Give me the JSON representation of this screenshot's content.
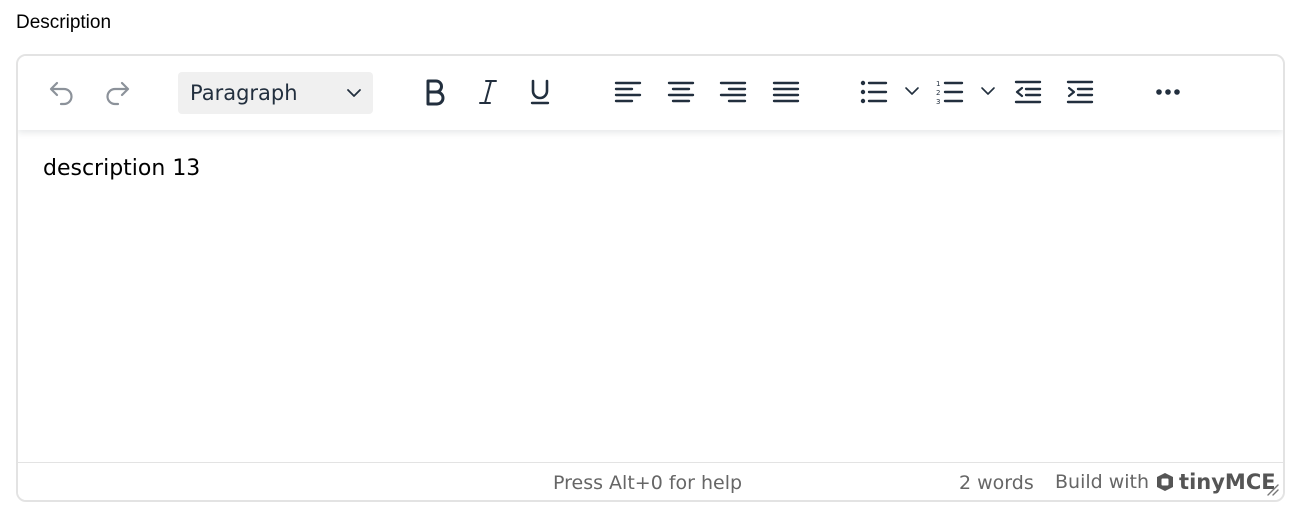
{
  "field": {
    "label": "Description"
  },
  "toolbar": {
    "block_format": {
      "selected": "Paragraph"
    },
    "buttons": [
      {
        "name": "undo-icon"
      },
      {
        "name": "redo-icon"
      },
      {
        "name": "bold-icon"
      },
      {
        "name": "italic-icon"
      },
      {
        "name": "underline-icon"
      },
      {
        "name": "align-left-icon"
      },
      {
        "name": "align-center-icon"
      },
      {
        "name": "align-right-icon"
      },
      {
        "name": "align-justify-icon"
      },
      {
        "name": "bullet-list-icon"
      },
      {
        "name": "numbered-list-icon"
      },
      {
        "name": "outdent-icon"
      },
      {
        "name": "indent-icon"
      },
      {
        "name": "more-icon"
      }
    ]
  },
  "content": {
    "text": "description 13"
  },
  "statusbar": {
    "help": "Press Alt+0 for help",
    "word_count": "2 words",
    "branding_prefix": "Build with",
    "branding_name": "tinyMCE"
  },
  "colors": {
    "icon": "#222f3e",
    "icon_disabled": "#8c929a",
    "border": "#e3e3e3",
    "select_bg": "#f0f0f0",
    "status_text": "#666666"
  }
}
